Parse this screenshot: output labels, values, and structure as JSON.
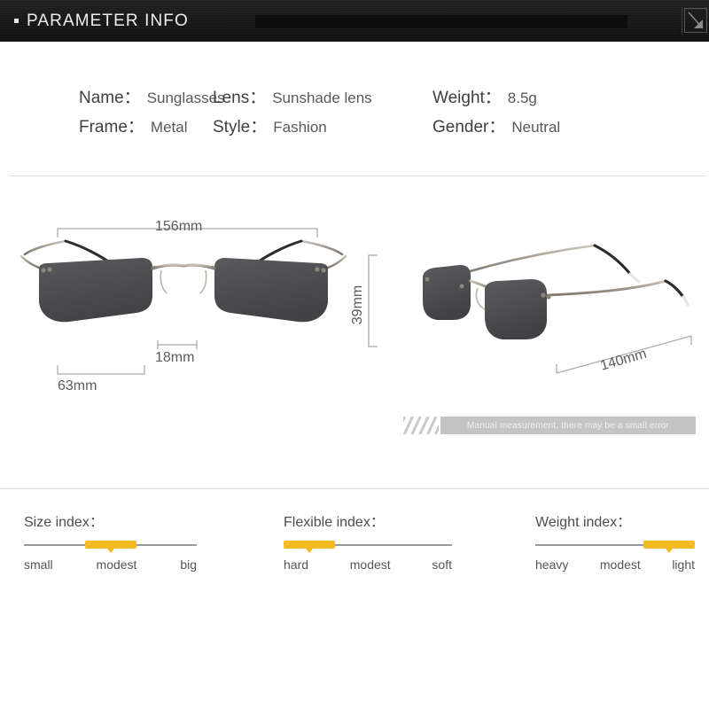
{
  "header": {
    "title": "PARAMETER INFO",
    "bullet_icon": "square-bullet-icon",
    "corner_icon": "arrow-box-icon"
  },
  "specs": {
    "rows": [
      [
        {
          "label": "Name：",
          "value": "Sunglasses"
        },
        {
          "label": "Lens：",
          "value": "Sunshade lens"
        },
        {
          "label": "Weight：",
          "value": "8.5g"
        }
      ],
      [
        {
          "label": "Frame：",
          "value": "Metal"
        },
        {
          "label": "Style：",
          "value": "Fashion"
        },
        {
          "label": "Gender：",
          "value": "Neutral"
        }
      ]
    ]
  },
  "diagram": {
    "front_view": {
      "name": "sunglasses-front-view",
      "dimensions": {
        "total_width": "156mm",
        "bridge": "18mm",
        "lens_width": "63mm"
      }
    },
    "side_view": {
      "name": "sunglasses-side-view",
      "dimensions": {
        "lens_height": "39mm",
        "temple_length": "140mm"
      }
    },
    "disclaimer": "Manual measurement, there may be a small error"
  },
  "indexes": [
    {
      "title": "Size index：",
      "labels": [
        "small",
        "modest",
        "big"
      ],
      "selected": "modest",
      "position": "pos-mid"
    },
    {
      "title": "Flexible index：",
      "labels": [
        "hard",
        "modest",
        "soft"
      ],
      "selected": "hard",
      "position": "pos-left"
    },
    {
      "title": "Weight index：",
      "labels": [
        "heavy",
        "modest",
        "light"
      ],
      "selected": "light",
      "position": "pos-right"
    }
  ],
  "colors": {
    "accent": "#f5b921",
    "header_bg": "#141414",
    "lens": "#4e4e52",
    "frame_metal": "#9d9589",
    "divider": "#dcdcdc",
    "dim_line": "#9a9a9a"
  }
}
